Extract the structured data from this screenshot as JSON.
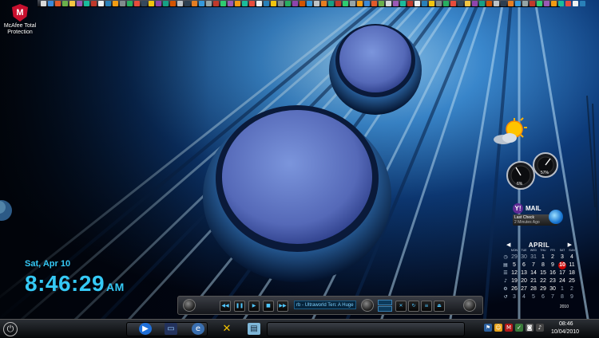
{
  "desktop": {
    "shortcut": {
      "label": "McAfee Total Protection",
      "icon": "mcafee-shield-icon"
    }
  },
  "clock_gadget": {
    "date": "Sat, Apr 10",
    "time": "8:46:29",
    "ampm": "AM"
  },
  "weather_gadget": {
    "icon": "sun-cloud-icon"
  },
  "meters_gadget": {
    "cpu_value": "6%",
    "ram_value": "57%"
  },
  "mail_gadget": {
    "brand_icon": "yahoo-y-icon",
    "title": "MAIL",
    "line1": "Last Check",
    "line2": "2 Minutes Ago"
  },
  "calendar_gadget": {
    "month": "APRIL",
    "year": "2010",
    "weekdays": [
      "MON",
      "TUE",
      "WED",
      "THU",
      "FRI",
      "SAT",
      "SUN"
    ],
    "weeks": [
      [
        "29",
        "30",
        "31",
        "1",
        "2",
        "3",
        "4"
      ],
      [
        "5",
        "6",
        "7",
        "8",
        "9",
        "10",
        "11"
      ],
      [
        "12",
        "13",
        "14",
        "15",
        "16",
        "17",
        "18"
      ],
      [
        "19",
        "20",
        "21",
        "22",
        "23",
        "24",
        "25"
      ],
      [
        "26",
        "27",
        "28",
        "29",
        "30",
        "1",
        "2"
      ],
      [
        "3",
        "4",
        "5",
        "6",
        "7",
        "8",
        "9"
      ]
    ],
    "today": "10"
  },
  "media_player": {
    "now_playing": "rb - Ultraworld Ten: A Huge"
  },
  "taskbar": {
    "clock_time": "08:46",
    "clock_date": "10/04/2010"
  },
  "colors": {
    "accent": "#35c9f5",
    "highlight": "#cc0000",
    "taskbar": "#0a0b0d"
  }
}
